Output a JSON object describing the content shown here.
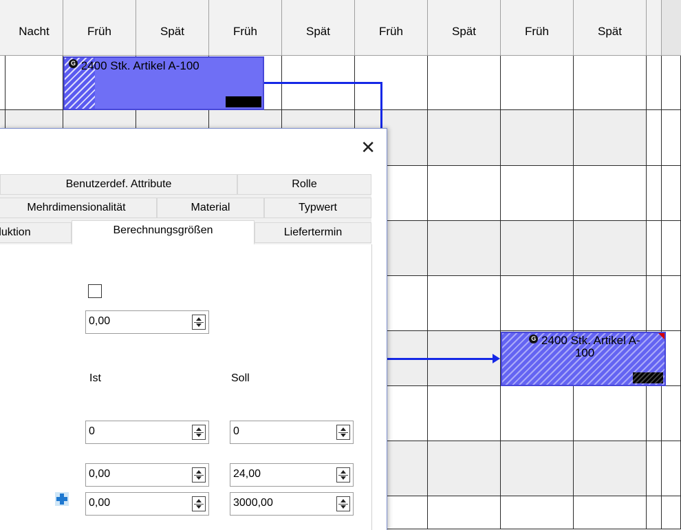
{
  "gantt": {
    "shift_headers": [
      "Nacht",
      "Früh",
      "Spät",
      "Früh",
      "Spät",
      "Früh",
      "Spät",
      "Früh",
      "Spät"
    ],
    "bars": [
      {
        "label": "2400 Stk. Artikel A-100",
        "badge": "G"
      },
      {
        "label_line1": "2400 Stk. Artikel A-",
        "label_line2": "100",
        "badge": "G"
      }
    ],
    "colors": {
      "bar": "#6f6ff5",
      "link": "#1528e6",
      "grid": "#2a2a2a"
    }
  },
  "dialog": {
    "close_icon": "close-icon",
    "tabs": {
      "row1": [
        "Benutzerdef. Attribute",
        "Rolle"
      ],
      "row2": [
        "Mehrdimensionalität",
        "Material",
        "Typwert"
      ],
      "row3": [
        "duktion",
        "Berechnungsgrößen",
        "Liefertermin"
      ]
    },
    "active_tab": "Berechnungsgrößen",
    "fields": {
      "top_value": "0,00",
      "ist_label": "Ist",
      "soll_label": "Soll",
      "rows": [
        {
          "ist": "0",
          "soll": "0"
        },
        {
          "ist": "0,00",
          "soll": "24,00"
        },
        {
          "ist": "0,00",
          "soll": "3000,00"
        }
      ]
    }
  }
}
